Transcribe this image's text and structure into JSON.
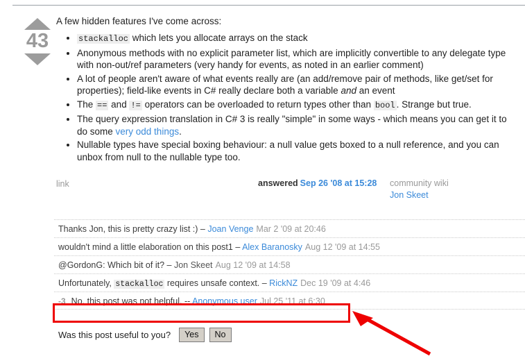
{
  "post": {
    "vote_score": "43",
    "upvote_icon": "triangle-up-icon",
    "downvote_icon": "triangle-down-icon",
    "intro": "A few hidden features I've come across:",
    "bullets": [
      {
        "id": "stackalloc",
        "segments": [
          {
            "type": "code",
            "text": "stackalloc"
          },
          {
            "type": "text",
            "text": " which lets you allocate arrays on the stack"
          }
        ]
      },
      {
        "id": "anonymous-methods",
        "segments": [
          {
            "type": "text",
            "text": "Anonymous methods with no explicit parameter list, which are implicitly convertible to any delegate type with non-out/ref parameters (very handy for events, as noted in an earlier comment)"
          }
        ]
      },
      {
        "id": "events",
        "segments": [
          {
            "type": "text",
            "text": "A lot of people aren't aware of what events really are (an add/remove pair of methods, like get/set for properties); field-like events in C# really declare both a variable "
          },
          {
            "type": "em",
            "text": "and"
          },
          {
            "type": "text",
            "text": " an event"
          }
        ]
      },
      {
        "id": "operators",
        "segments": [
          {
            "type": "text",
            "text": "The "
          },
          {
            "type": "code",
            "text": "=="
          },
          {
            "type": "text",
            "text": " and "
          },
          {
            "type": "code",
            "text": "!="
          },
          {
            "type": "text",
            "text": " operators can be overloaded to return types other than "
          },
          {
            "type": "code",
            "text": "bool"
          },
          {
            "type": "text",
            "text": ". Strange but true."
          }
        ]
      },
      {
        "id": "query-expression",
        "segments": [
          {
            "type": "text",
            "text": "The query expression translation in C# 3 is really \"simple\" in some ways - which means you can get it to do some "
          },
          {
            "type": "link",
            "text": "very odd things"
          },
          {
            "type": "text",
            "text": "."
          }
        ]
      },
      {
        "id": "nullable-types",
        "segments": [
          {
            "type": "text",
            "text": "Nullable types have special boxing behaviour: a null value gets boxed to a null reference, and you can unbox from null to the nullable type too."
          }
        ]
      }
    ],
    "footer": {
      "link_label": "link",
      "answered_label": "answered",
      "answered_date": "Sep 26 '08 at 15:28",
      "wiki_label": "community wiki",
      "author": "Jon Skeet"
    }
  },
  "comments": [
    {
      "score": "",
      "segments": [
        {
          "type": "text",
          "text": "Thanks Jon, this is pretty crazy list :) – "
        },
        {
          "type": "user",
          "text": "Joan Venge"
        }
      ],
      "date": "Mar 2 '09 at 20:46"
    },
    {
      "score": "",
      "segments": [
        {
          "type": "text",
          "text": "wouldn't mind a little elaboration on this post1 – "
        },
        {
          "type": "user",
          "text": "Alex Baranosky"
        }
      ],
      "date": "Aug 12 '09 at 14:55"
    },
    {
      "score": "",
      "segments": [
        {
          "type": "text",
          "text": "@GordonG: Which bit of it? – "
        },
        {
          "type": "user-plain",
          "text": "Jon Skeet"
        }
      ],
      "date": "Aug 12 '09 at 14:58"
    },
    {
      "score": "",
      "segments": [
        {
          "type": "text",
          "text": "Unfortunately, "
        },
        {
          "type": "code",
          "text": "stackalloc"
        },
        {
          "type": "text",
          "text": " requires unsafe context. – "
        },
        {
          "type": "user",
          "text": "RickNZ"
        }
      ],
      "date": "Dec 19 '09 at 4:46"
    },
    {
      "score": "-3",
      "segments": [
        {
          "type": "text",
          "text": "No, this post was not helpful. -- "
        },
        {
          "type": "user",
          "text": "Anonymous user"
        }
      ],
      "date": "Jul 25 '11 at 6:30"
    }
  ],
  "useful_prompt": {
    "question": "Was this post useful to you?",
    "yes_label": "Yes",
    "no_label": "No"
  },
  "annotation": {
    "highlight_color": "#ee0000",
    "arrow_icon": "red-arrow-icon",
    "target_comment_index": 4
  }
}
